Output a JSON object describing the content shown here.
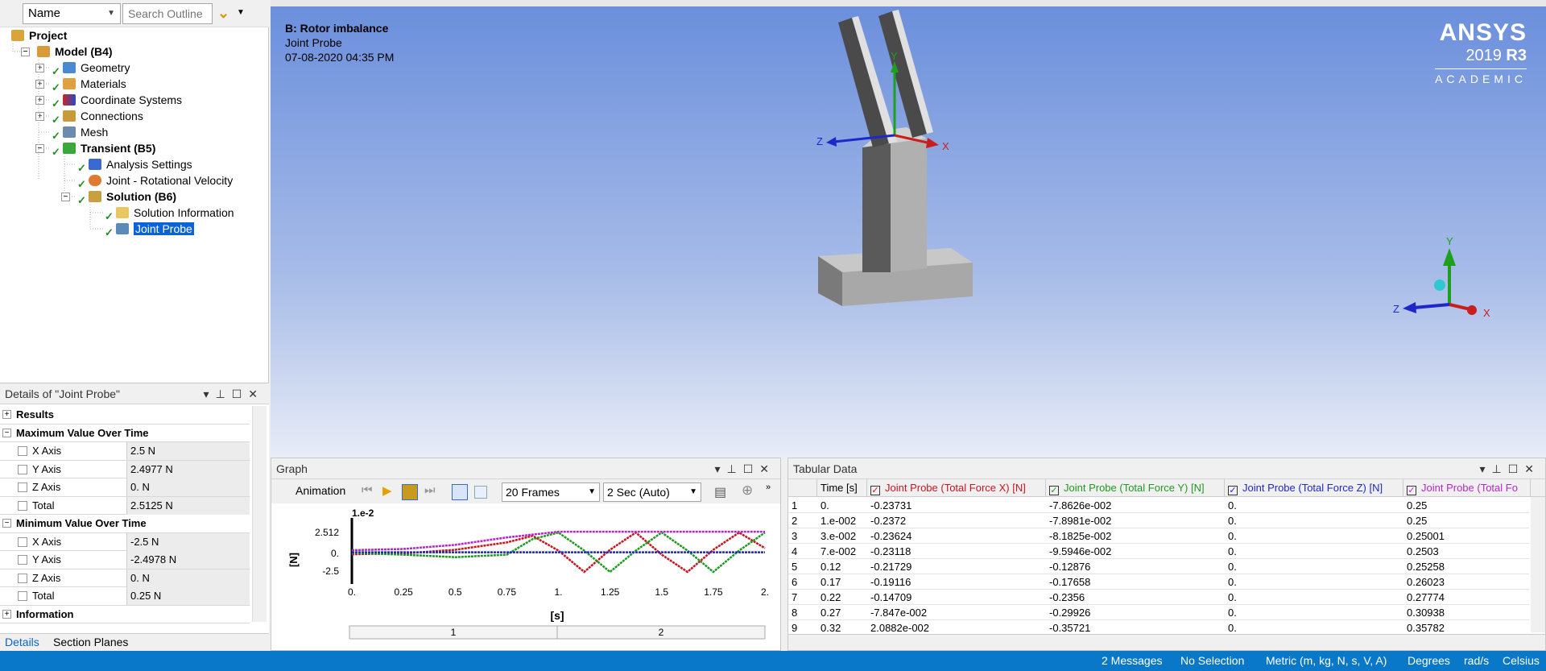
{
  "outline": {
    "name_combo": "Name",
    "search_placeholder": "Search Outline",
    "nodes": [
      {
        "label": "Project"
      },
      {
        "label": "Model (B4)"
      },
      {
        "label": "Geometry"
      },
      {
        "label": "Materials"
      },
      {
        "label": "Coordinate Systems"
      },
      {
        "label": "Connections"
      },
      {
        "label": "Mesh"
      },
      {
        "label": "Transient (B5)"
      },
      {
        "label": "Analysis Settings"
      },
      {
        "label": "Joint - Rotational Velocity"
      },
      {
        "label": "Solution (B6)"
      },
      {
        "label": "Solution Information"
      },
      {
        "label": "Joint Probe"
      }
    ]
  },
  "details": {
    "title": "Details of \"Joint Probe\"",
    "groups": {
      "results": "Results",
      "max": "Maximum Value Over Time",
      "min": "Minimum Value Over Time",
      "info": "Information"
    },
    "max_rows": [
      {
        "k": "X Axis",
        "v": "2.5 N"
      },
      {
        "k": "Y Axis",
        "v": "2.4977 N"
      },
      {
        "k": "Z Axis",
        "v": "0. N"
      },
      {
        "k": "Total",
        "v": "2.5125 N"
      }
    ],
    "min_rows": [
      {
        "k": "X Axis",
        "v": "-2.5 N"
      },
      {
        "k": "Y Axis",
        "v": "-2.4978 N"
      },
      {
        "k": "Z Axis",
        "v": "0. N"
      },
      {
        "k": "Total",
        "v": "0.25 N"
      }
    ],
    "tabs": [
      "Details",
      "Section Planes"
    ]
  },
  "viewport": {
    "info_title": "B: Rotor imbalance",
    "info_sub": "Joint Probe",
    "info_date": "07-08-2020 04:35 PM",
    "brand": "ANSYS",
    "version_prefix": "2019 ",
    "version": "R3",
    "edition": "ACADEMIC",
    "axis_x": "X",
    "axis_y": "Y",
    "axis_z": "Z"
  },
  "graph": {
    "title": "Graph",
    "animation_label": "Animation",
    "frames": "20 Frames",
    "duration": "2 Sec (Auto)",
    "y_scale": "1.e-2",
    "y_unit": "[N]",
    "x_unit": "[s]",
    "y_ticks": [
      "2.512",
      "0.",
      "-2.5"
    ],
    "x_ticks": [
      "0.",
      "0.25",
      "0.5",
      "0.75",
      "1.",
      "1.25",
      "1.5",
      "1.75",
      "2."
    ],
    "steps": [
      "1",
      "2"
    ]
  },
  "chart_data": {
    "type": "line",
    "xlabel": "[s]",
    "ylabel": "[N]",
    "xlim": [
      0,
      2
    ],
    "ylim": [
      -2.5,
      2.512
    ],
    "series": [
      {
        "name": "Joint Probe (Total Force X) [N]",
        "color": "#c8141e",
        "x": [
          0,
          0.25,
          0.5,
          0.75,
          0.875,
          1.0,
          1.125,
          1.25,
          1.375,
          1.5,
          1.625,
          1.75,
          1.875,
          2.0
        ],
        "y": [
          -0.24,
          -0.15,
          0.3,
          1.2,
          2.0,
          0.2,
          -2.4,
          0.3,
          2.4,
          -0.3,
          -2.4,
          0.3,
          2.4,
          0.5
        ]
      },
      {
        "name": "Joint Probe (Total Force Y) [N]",
        "color": "#1e9a1e",
        "x": [
          0,
          0.25,
          0.5,
          0.75,
          0.875,
          1.0,
          1.125,
          1.25,
          1.375,
          1.5,
          1.625,
          1.75,
          1.875,
          2.0
        ],
        "y": [
          -0.08,
          -0.3,
          -0.6,
          -0.3,
          1.6,
          2.4,
          0.2,
          -2.4,
          0.2,
          2.4,
          0.2,
          -2.4,
          0.2,
          2.4
        ]
      },
      {
        "name": "Joint Probe (Total Force Z) [N]",
        "color": "#1e28c8",
        "x": [
          0,
          2.0
        ],
        "y": [
          0,
          0
        ]
      },
      {
        "name": "Joint Probe (Total Force Total) [N]",
        "color": "#b428c8",
        "x": [
          0,
          0.25,
          0.5,
          0.75,
          1.0,
          1.25,
          1.5,
          1.75,
          2.0
        ],
        "y": [
          0.25,
          0.4,
          0.9,
          1.8,
          2.5,
          2.5,
          2.5,
          2.5,
          2.5
        ]
      }
    ]
  },
  "tabular": {
    "title": "Tabular Data",
    "headers": [
      "Time [s]",
      "Joint Probe (Total Force X) [N]",
      "Joint Probe (Total Force Y) [N]",
      "Joint Probe (Total Force Z) [N]",
      "Joint Probe (Total Fo"
    ],
    "header_colors": [
      "#000000",
      "#c8141e",
      "#1e9a1e",
      "#1e28c8",
      "#b428c8"
    ],
    "rows": [
      [
        "1",
        "0.",
        "-0.23731",
        "-7.8626e-002",
        "0.",
        "0.25"
      ],
      [
        "2",
        "1.e-002",
        "-0.2372",
        "-7.8981e-002",
        "0.",
        "0.25"
      ],
      [
        "3",
        "3.e-002",
        "-0.23624",
        "-8.1825e-002",
        "0.",
        "0.25001"
      ],
      [
        "4",
        "7.e-002",
        "-0.23118",
        "-9.5946e-002",
        "0.",
        "0.2503"
      ],
      [
        "5",
        "0.12",
        "-0.21729",
        "-0.12876",
        "0.",
        "0.25258"
      ],
      [
        "6",
        "0.17",
        "-0.19116",
        "-0.17658",
        "0.",
        "0.26023"
      ],
      [
        "7",
        "0.22",
        "-0.14709",
        "-0.2356",
        "0.",
        "0.27774"
      ],
      [
        "8",
        "0.27",
        "-7.847e-002",
        "-0.29926",
        "0.",
        "0.30938"
      ],
      [
        "9",
        "0.32",
        "2.0882e-002",
        "-0.35721",
        "0.",
        "0.35782"
      ]
    ]
  },
  "status": {
    "messages": "2 Messages",
    "selection": "No Selection",
    "units": "Metric (m, kg, N, s, V, A)",
    "temp_unit": "Degrees",
    "rot_unit": "rad/s",
    "celsius": "Celsius"
  }
}
